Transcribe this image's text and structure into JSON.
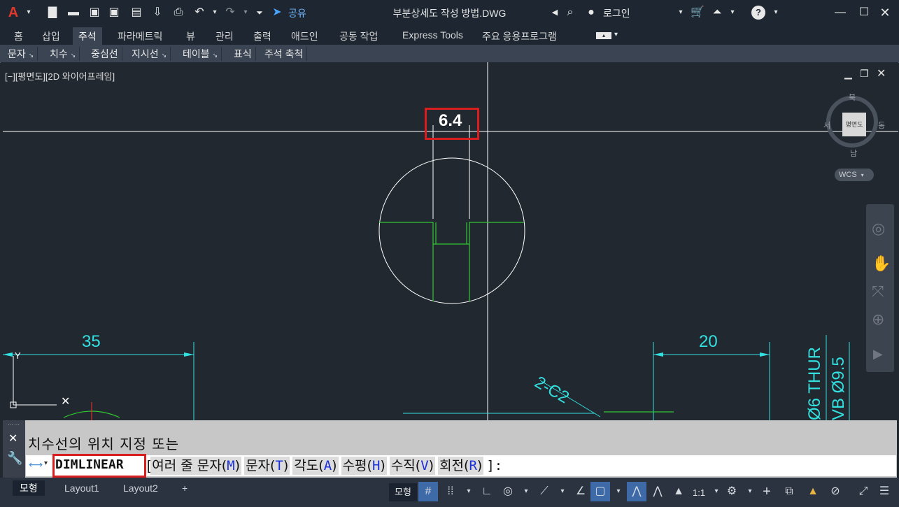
{
  "window": {
    "title": "부분상세도 작성 방법.DWG",
    "share_label": "공유",
    "login_label": "로그인",
    "help_label": "?"
  },
  "ribbon": {
    "tabs": [
      "홈",
      "삽입",
      "주석",
      "파라메트릭",
      "뷰",
      "관리",
      "출력",
      "애드인",
      "공동 작업",
      "Express Tools",
      "주요 응용프로그램"
    ],
    "active_tab": "주석",
    "panels": [
      "문자",
      "치수",
      "중심선",
      "지시선",
      "테이블",
      "표식",
      "주석 축척"
    ]
  },
  "viewport": {
    "label": "[−][평면도][2D 와이어프레임]",
    "viewcube_face": "평면도",
    "compass": {
      "north": "북",
      "south": "남",
      "east": "동",
      "west": "서"
    },
    "ucs_label": "WCS"
  },
  "drawing": {
    "dim_top": "6.4",
    "dim_left": "35",
    "dim_right": "20",
    "chamfer_note": "2-C2",
    "vertical_note_1": "Ø6 THUR",
    "vertical_note_2": "VB Ø9.5",
    "colors": {
      "dimension": "#33e0e0",
      "geometry": "#33c633",
      "crosshair": "#ffffff",
      "highlight": "#d81e1e"
    }
  },
  "command": {
    "prompt": "치수선의 위치 지정 또는",
    "name": "DIMLINEAR",
    "open_bracket": "[",
    "close": "]:",
    "options": [
      {
        "label": "여러 줄 문자(",
        "key": "M",
        "end": ")"
      },
      {
        "label": "문자(",
        "key": "T",
        "end": ")"
      },
      {
        "label": "각도(",
        "key": "A",
        "end": ")"
      },
      {
        "label": "수평(",
        "key": "H",
        "end": ")"
      },
      {
        "label": "수직(",
        "key": "V",
        "end": ")"
      },
      {
        "label": "회전(",
        "key": "R",
        "end": ")"
      }
    ]
  },
  "status_bar": {
    "layout_tabs": [
      "모형",
      "Layout1",
      "Layout2"
    ],
    "add_tab": "+",
    "model_label": "모형",
    "scale": "1:1"
  }
}
